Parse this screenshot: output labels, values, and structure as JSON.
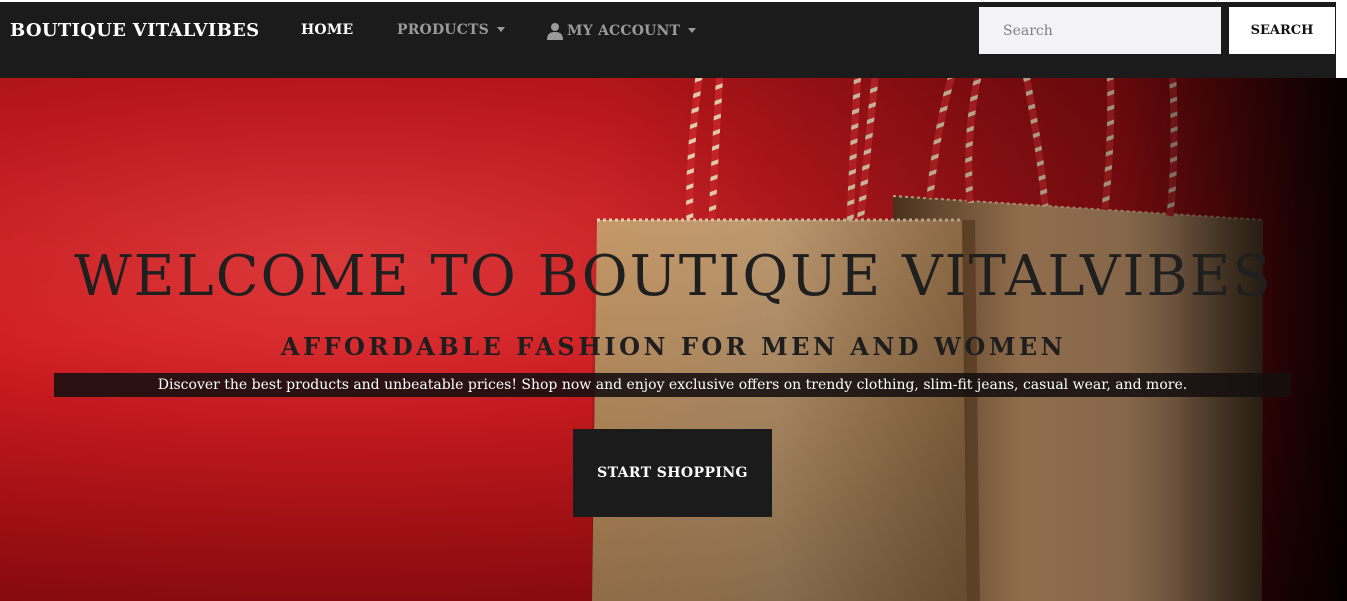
{
  "navbar": {
    "brand": "BOUTIQUE VITALVIBES",
    "links": [
      {
        "label": "HOME",
        "active": true
      },
      {
        "label": "PRODUCTS",
        "dropdown": true
      },
      {
        "label": "MY ACCOUNT",
        "dropdown": true,
        "icon": "user-icon"
      }
    ],
    "search": {
      "placeholder": "Search",
      "value": "",
      "button_label": "SEARCH"
    }
  },
  "hero": {
    "title": "WELCOME TO BOUTIQUE VITALVIBES",
    "subtitle": "AFFORDABLE FASHION FOR MEN AND WOMEN",
    "description": "Discover the best products and unbeatable prices! Shop now and enjoy exclusive offers on trendy clothing, slim-fit jeans, casual wear, and more.",
    "cta_label": "START SHOPPING",
    "background_image": "kraft-paper-shopping-bags-with-red-white-twine-handles-on-red-background"
  },
  "colors": {
    "navbar_bg": "#1b1b1b",
    "hero_red": "#cc1a1f",
    "text_dark": "#1f1f1f",
    "cta_bg": "#1b1b1b",
    "bag_kraft": "#c99d6a"
  }
}
